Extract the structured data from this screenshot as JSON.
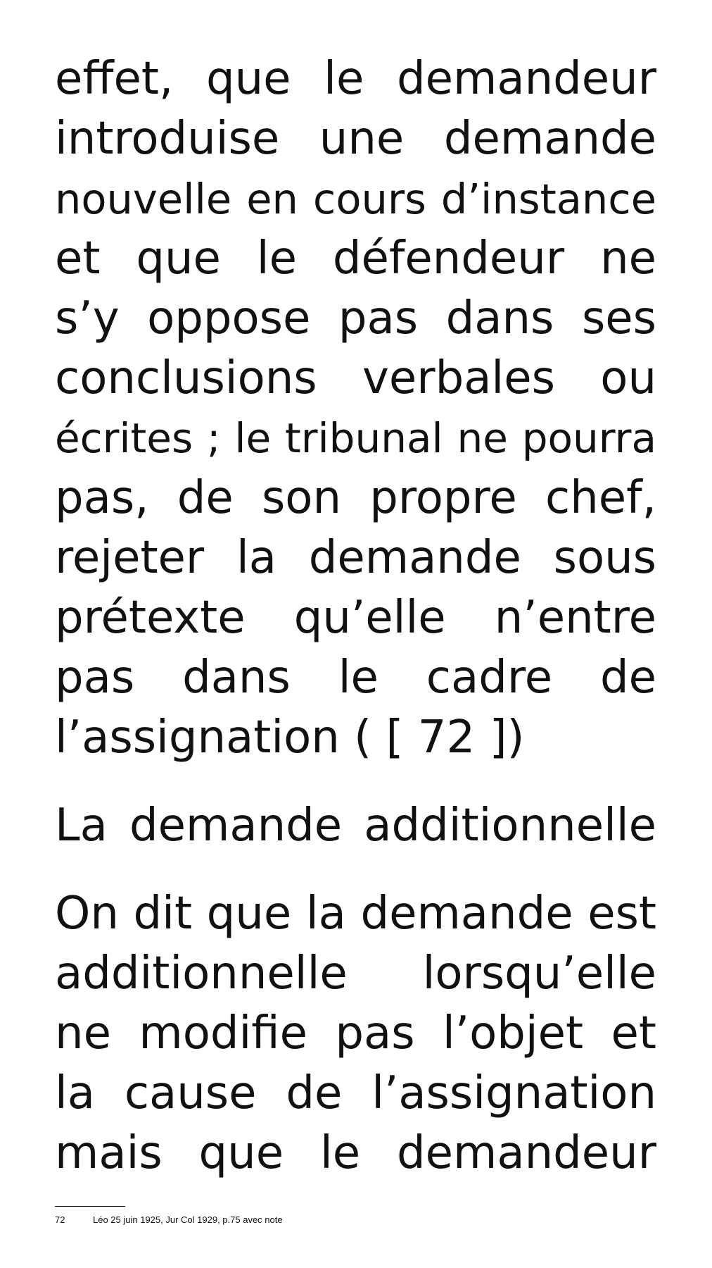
{
  "paragraph_1": {
    "lines": [
      "effet, que le demandeur",
      "introduise une demande",
      "nouvelle en cours d’instance",
      "et que le défendeur ne",
      "s’y oppose pas dans ses",
      "conclusions verbales ou",
      "écrites ; le tribunal ne pourra",
      "pas, de son propre chef,",
      "rejeter la demande sous",
      "prétexte qu’elle n’entre",
      "pas dans le cadre de",
      "l’assignation ( [ 72 ])"
    ]
  },
  "section_heading": "La demande additionnelle",
  "paragraph_2": {
    "lines": [
      "On dit que la demande est",
      "additionnelle lorsqu’elle",
      "ne modifie pas l’objet et",
      "la cause de l’assignation",
      "mais que le demandeur"
    ]
  },
  "footnote": {
    "number": "72",
    "text": "Léo 25 juin 1925, Jur Col 1929, p.75 avec note"
  }
}
